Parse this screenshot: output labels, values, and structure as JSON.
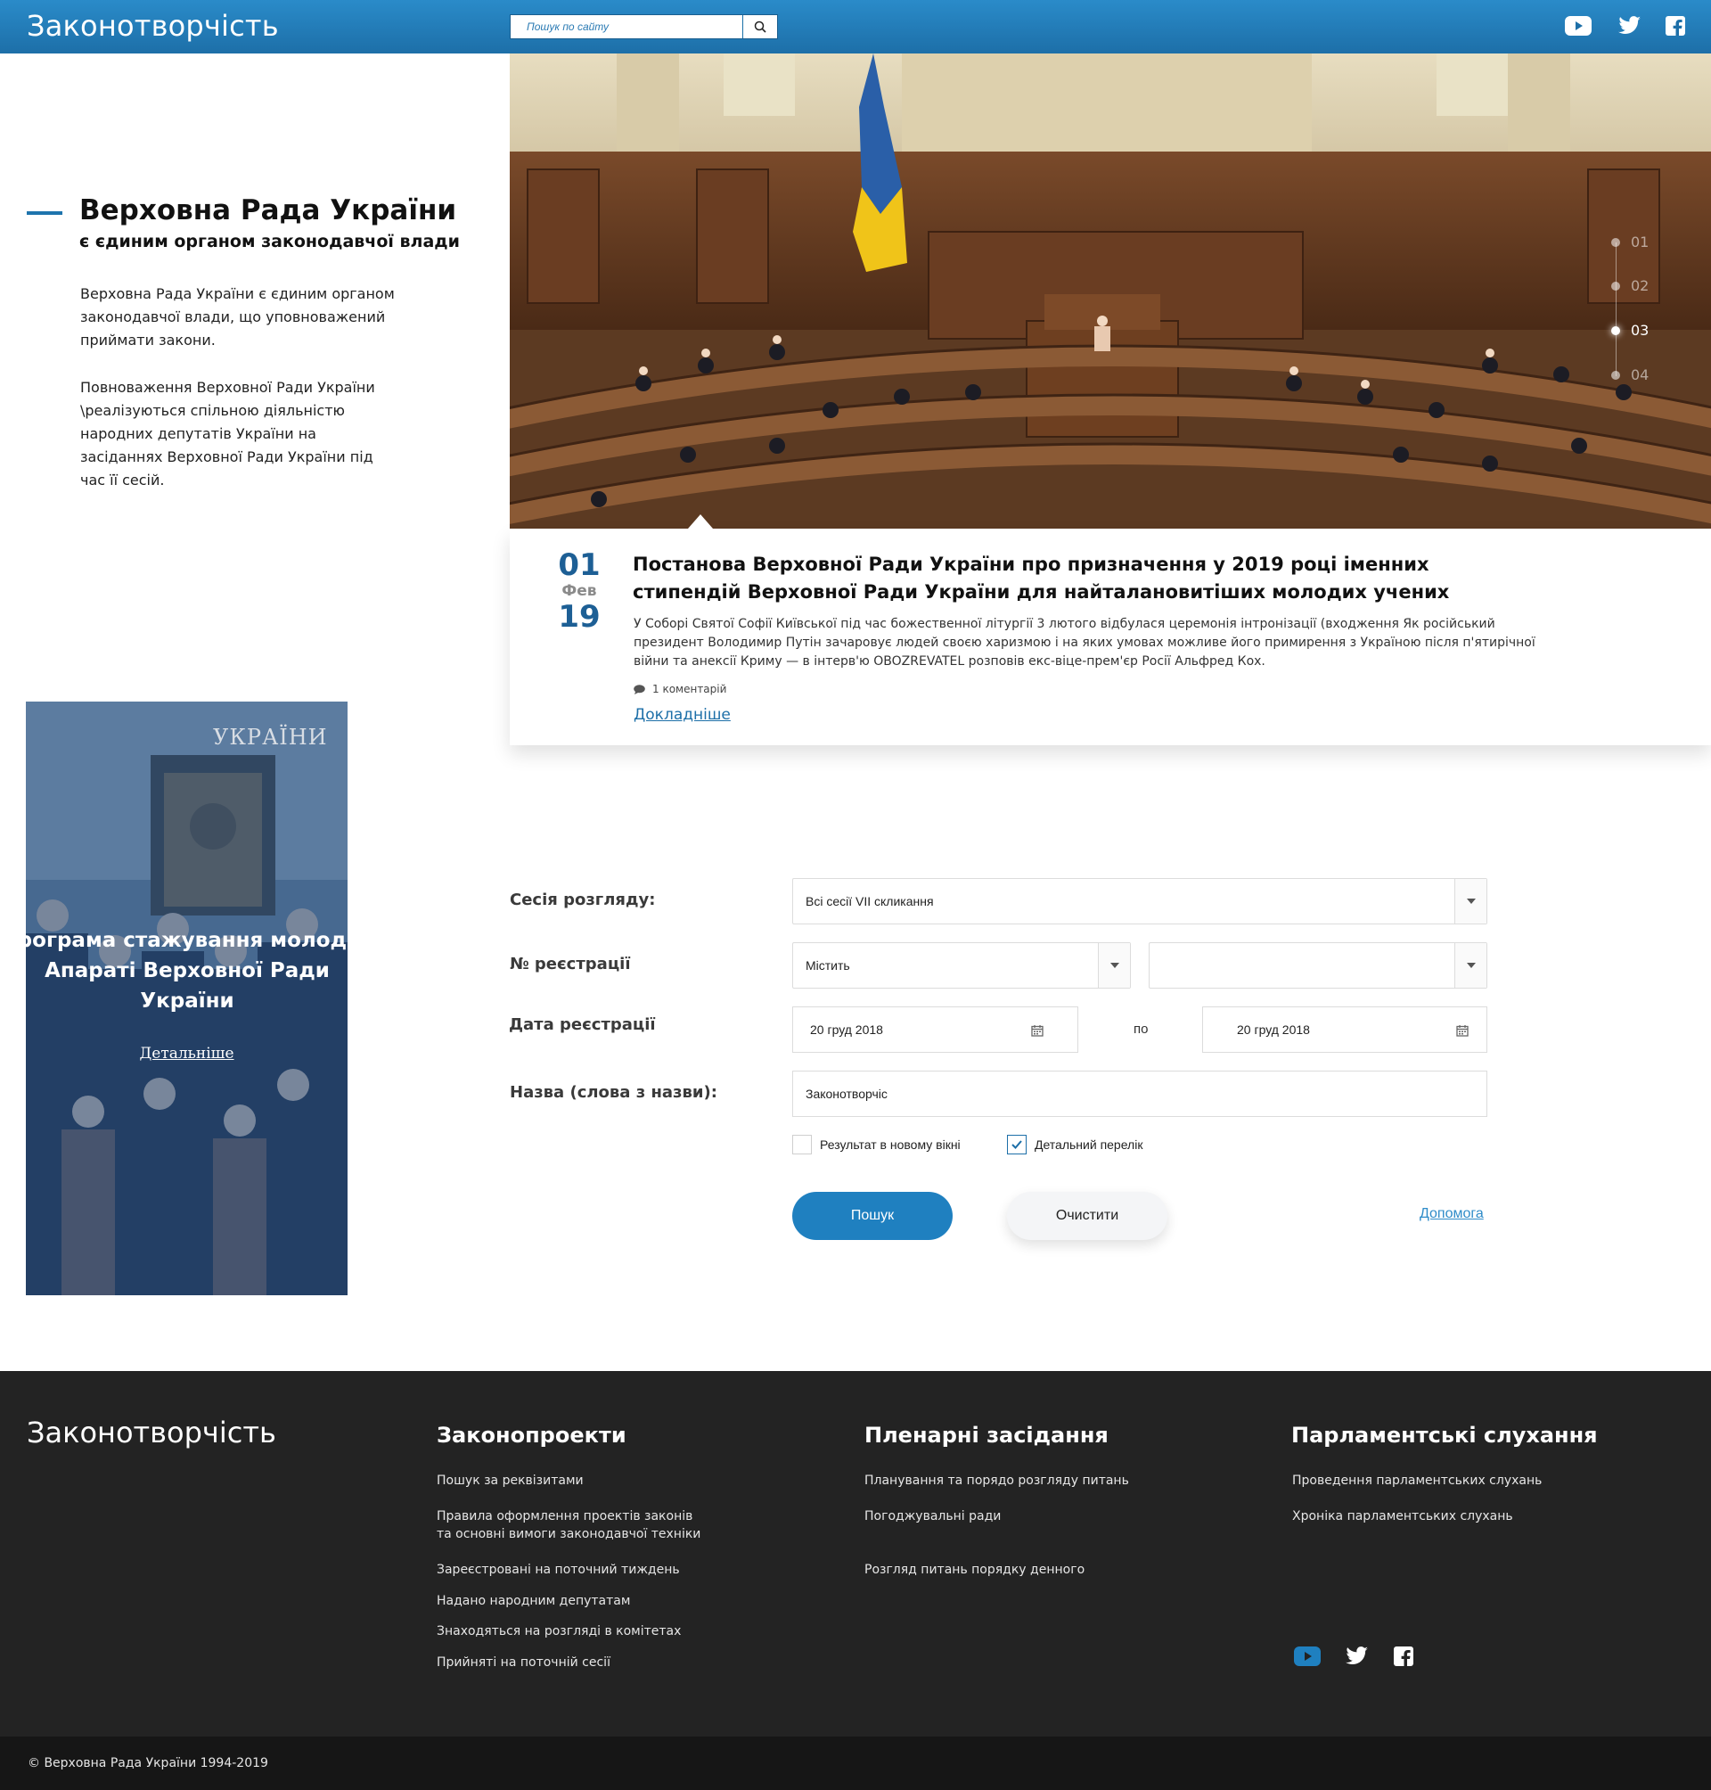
{
  "header": {
    "site_title": "Законотворчість",
    "search_placeholder": "Пошук по сайту",
    "social": [
      "youtube-icon",
      "twitter-icon",
      "facebook-icon"
    ]
  },
  "hero": {
    "slides": [
      "01",
      "02",
      "03",
      "04"
    ],
    "active_slide": "03"
  },
  "news": {
    "day": "01",
    "month": "Фев",
    "year": "19",
    "title": "Постанова Верховної Ради України про призначення у 2019 році іменних стипендій Верховної Ради України для найталановитіших молодих учених",
    "text": "У Соборі Святої Софії Київської під час божественної літургії 3 лютого відбулася церемонія інтронізації (входження Як російський президент Володимир Путін зачаровує людей своєю харизмою і на яких умовах можливе його примирення з Україною після п'ятирічної війни та анексії Криму — в інтерв'ю OBOZREVATEL розповів екс-віце-прем'єр Росії Альфред Кох.",
    "comments": "1 коментарій",
    "more_link": "Докладніше"
  },
  "intro": {
    "title": "Верховна Рада України",
    "subtitle": "є єдиним органом законодавчої влади",
    "paragraph1": "Верховна Рада України є єдиним органом законодавчої влади, що уповноважений приймати закони.",
    "paragraph2": "Повноваження Верховної Ради України \\реалізуються спільною діяльністю народних депутатів України на засіданнях Верховної Ради України під час її сесій."
  },
  "promo": {
    "building_text": "УКРАЇНИ",
    "title": "Програма стажування молоді в Апараті Верховної Ради України",
    "link": "Детальніше"
  },
  "form": {
    "session_label": "Сесія розгляду:",
    "session_value": "Всі сесії VII скликання",
    "reg_number_label": "№ реєстрації",
    "reg_number_mode": "Містить",
    "reg_number_value": "",
    "reg_date_label": "Дата реєстрації",
    "date_from": "20 груд 2018",
    "date_separator": "по",
    "date_to": "20 груд 2018",
    "name_label": "Назва (слова з назви):",
    "name_value": "Законотворчіс",
    "checkbox_new_window": "Результат в новому вікні",
    "checkbox_new_window_checked": false,
    "checkbox_detailed": "Детальний перелік",
    "checkbox_detailed_checked": true,
    "search_button": "Пошук",
    "clear_button": "Очистити",
    "help_link": "Допомога"
  },
  "footer": {
    "logo": "Законотворчість",
    "columns": [
      {
        "heading": "Законопроекти",
        "links": [
          "Пошук за реквізитами",
          "Правила оформлення проектів законів та основні вимоги законодавчої техніки",
          "Зареєстровані на поточний тиждень",
          "Надано народним депутатам",
          "Знаходяться на розгляді в комітетах",
          "Прийняті на поточній сесії"
        ]
      },
      {
        "heading": "Пленарні засідання",
        "links": [
          "Планування та порядо розгляду питань",
          "Погоджувальні ради",
          "Розгляд питань порядку денного"
        ]
      },
      {
        "heading": "Парламентські слухання",
        "links": [
          "Проведення парламентських слухань",
          "Хроніка парламентських слухань"
        ]
      }
    ],
    "copyright": "© Верховна Рада України 1994-2019"
  },
  "colors": {
    "primary": "#1f80c0",
    "header": "#1d6fa8",
    "footer_bg": "#232323",
    "bottom_bar": "#161616"
  }
}
